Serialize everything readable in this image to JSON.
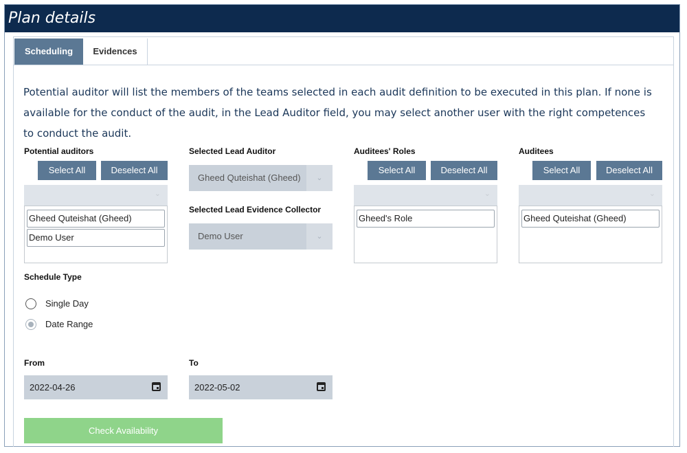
{
  "window": {
    "title": "Plan details"
  },
  "tabs": [
    {
      "label": "Scheduling",
      "active": true
    },
    {
      "label": "Evidences",
      "active": false
    }
  ],
  "intro_text": "Potential auditor will list the members of the teams selected in each audit definition to be executed in this plan. If none is available for the conduct of the audit, in the Lead Auditor field, you may select another user with the right competences to conduct the audit.",
  "potential_auditors": {
    "label": "Potential auditors",
    "select_all": "Select All",
    "deselect_all": "Deselect All",
    "items": [
      "Gheed Quteishat (Gheed)",
      "Demo User"
    ]
  },
  "lead_auditor": {
    "label": "Selected Lead Auditor",
    "value": "Gheed Quteishat (Gheed)"
  },
  "lead_evidence_collector": {
    "label": "Selected Lead Evidence Collector",
    "value": "Demo User"
  },
  "auditees_roles": {
    "label": "Auditees' Roles",
    "select_all": "Select All",
    "deselect_all": "Deselect All",
    "items": [
      "Gheed's Role"
    ]
  },
  "auditees": {
    "label": "Auditees",
    "select_all": "Select All",
    "deselect_all": "Deselect All",
    "items": [
      "Gheed Quteishat (Gheed)"
    ]
  },
  "schedule_type": {
    "label": "Schedule Type",
    "options": [
      {
        "label": "Single Day",
        "selected": false
      },
      {
        "label": "Date Range",
        "selected": true
      }
    ]
  },
  "from": {
    "label": "From",
    "value": "2022-04-26"
  },
  "to": {
    "label": "To",
    "value": "2022-05-02"
  },
  "check_availability": "Check Availability",
  "icons": {
    "calendar": "calendar-icon",
    "chevron": "chevron-down-icon"
  },
  "colors": {
    "title_bar": "#0d2a4e",
    "button": "#5b7894",
    "check_button": "#8fd48a",
    "field_bg": "#c9d1da"
  }
}
